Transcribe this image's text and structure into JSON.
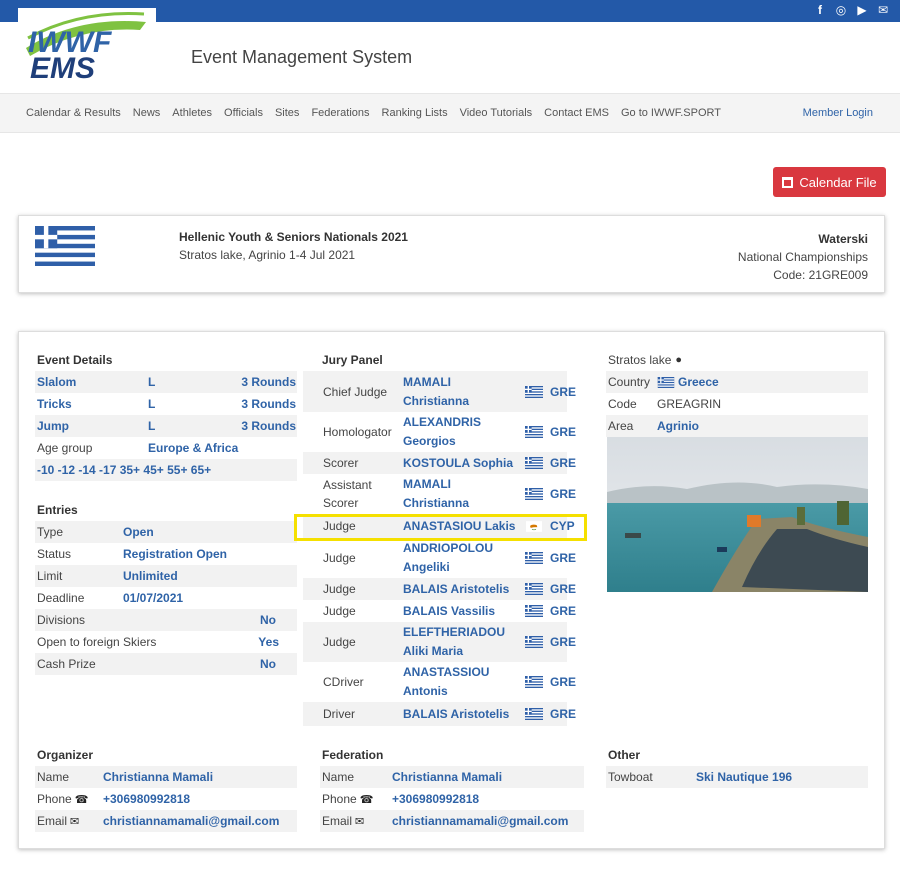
{
  "brand": {
    "logo_top": "IWWF",
    "logo_bottom": "EMS",
    "title": "Event Management System"
  },
  "social_icons": [
    "facebook-icon",
    "instagram-icon",
    "youtube-icon",
    "mail-icon"
  ],
  "nav": {
    "items": [
      "Calendar & Results",
      "News",
      "Athletes",
      "Officials",
      "Sites",
      "Federations",
      "Ranking Lists",
      "Video Tutorials",
      "Contact EMS",
      "Go to IWWF.SPORT"
    ],
    "login": "Member Login"
  },
  "calendar_button": "Calendar File",
  "event": {
    "title": "Hellenic Youth & Seniors Nationals 2021",
    "subtitle": "Stratos lake, Agrinio 1-4 Jul 2021",
    "sport": "Waterski",
    "category": "National Championships",
    "code": "Code: 21GRE009"
  },
  "details": {
    "title": "Event Details",
    "disciplines": [
      {
        "name": "Slalom",
        "level": "L",
        "rounds": "3 Rounds"
      },
      {
        "name": "Tricks",
        "level": "L",
        "rounds": "3 Rounds"
      },
      {
        "name": "Jump",
        "level": "L",
        "rounds": "3 Rounds"
      }
    ],
    "age_group_label": "Age group",
    "age_group_value": "Europe & Africa",
    "age_categories": "-10 -12 -14 -17 35+ 45+ 55+ 65+"
  },
  "entries": {
    "title": "Entries",
    "rows": [
      {
        "label": "Type",
        "value": "Open"
      },
      {
        "label": "Status",
        "value": "Registration Open"
      },
      {
        "label": "Limit",
        "value": "Unlimited"
      },
      {
        "label": "Deadline",
        "value": "01/07/2021"
      }
    ],
    "options": [
      {
        "label": "Divisions",
        "value": "No"
      },
      {
        "label": "Open to foreign Skiers",
        "value": "Yes"
      },
      {
        "label": "Cash Prize",
        "value": "No"
      }
    ]
  },
  "jury": {
    "title": "Jury Panel",
    "members": [
      {
        "role": "Chief Judge",
        "name": "MAMALI Christianna",
        "nat": "GRE"
      },
      {
        "role": "Homologator",
        "name": "ALEXANDRIS Georgios",
        "nat": "GRE"
      },
      {
        "role": "Scorer",
        "name": "KOSTOULA Sophia",
        "nat": "GRE"
      },
      {
        "role": "Assistant Scorer",
        "name": "MAMALI Christianna",
        "nat": "GRE"
      },
      {
        "role": "Judge",
        "name": "ANASTASIOU Lakis",
        "nat": "CYP"
      },
      {
        "role": "Judge",
        "name": "ANDRIOPOLOU Angeliki",
        "nat": "GRE"
      },
      {
        "role": "Judge",
        "name": "BALAIS Aristotelis",
        "nat": "GRE"
      },
      {
        "role": "Judge",
        "name": "BALAIS Vassilis",
        "nat": "GRE"
      },
      {
        "role": "Judge",
        "name": "ELEFTHERIADOU Aliki Maria",
        "nat": "GRE"
      },
      {
        "role": "CDriver",
        "name": "ANASTASSIOU Antonis",
        "nat": "GRE"
      },
      {
        "role": "Driver",
        "name": "BALAIS Aristotelis",
        "nat": "GRE"
      }
    ]
  },
  "site": {
    "name": "Stratos lake",
    "rows": [
      {
        "label": "Country",
        "value": "Greece"
      },
      {
        "label": "Code",
        "value": "GREAGRIN"
      },
      {
        "label": "Area",
        "value": "Agrinio"
      }
    ]
  },
  "organizer": {
    "title": "Organizer",
    "name_label": "Name",
    "name": "Christianna Mamali",
    "phone_label": "Phone",
    "phone": "+306980992818",
    "email_label": "Email",
    "email": "christiannamamali@gmail.com"
  },
  "federation": {
    "title": "Federation",
    "name_label": "Name",
    "name": "Christianna Mamali",
    "phone_label": "Phone",
    "phone": "+306980992818",
    "email_label": "Email",
    "email": "christiannamamali@gmail.com"
  },
  "other": {
    "title": "Other",
    "towboat_label": "Towboat",
    "towboat": "Ski Nautique 196"
  },
  "colors": {
    "brand_blue": "#2359a8",
    "link_blue": "#2f63a7",
    "red_button": "#d9383f",
    "highlight": "#f5e000"
  }
}
